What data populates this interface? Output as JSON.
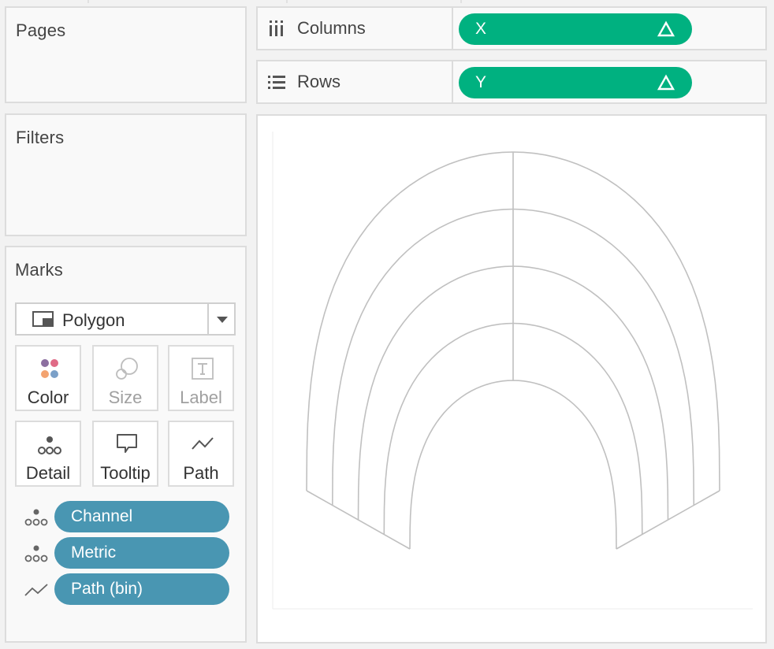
{
  "pages": {
    "title": "Pages"
  },
  "filters": {
    "title": "Filters"
  },
  "columns_shelf": {
    "label": "Columns",
    "pill": {
      "label": "X",
      "icon": "delta-icon",
      "color": "#00b180"
    }
  },
  "rows_shelf": {
    "label": "Rows",
    "pill": {
      "label": "Y",
      "icon": "delta-icon",
      "color": "#00b180"
    }
  },
  "marks": {
    "title": "Marks",
    "mark_type": {
      "label": "Polygon",
      "icon": "polygon-mark-icon"
    },
    "cards": [
      {
        "label": "Color",
        "icon": "color-icon",
        "enabled": true
      },
      {
        "label": "Size",
        "icon": "size-icon",
        "enabled": false
      },
      {
        "label": "Label",
        "icon": "label-icon",
        "enabled": false
      },
      {
        "label": "Detail",
        "icon": "detail-icon",
        "enabled": true
      },
      {
        "label": "Tooltip",
        "icon": "tooltip-icon",
        "enabled": true
      },
      {
        "label": "Path",
        "icon": "path-icon",
        "enabled": true
      }
    ],
    "fields": [
      {
        "label": "Channel",
        "type": "detail",
        "icon": "detail-icon",
        "color": "#4996b2"
      },
      {
        "label": "Metric",
        "type": "detail",
        "icon": "detail-icon",
        "color": "#4996b2"
      },
      {
        "label": "Path (bin)",
        "type": "path",
        "icon": "path-icon",
        "color": "#4996b2"
      }
    ]
  },
  "chart_data": {
    "type": "polygon",
    "bands": 4,
    "stroke_color": "#c0c0c0",
    "fill_color": "none"
  }
}
